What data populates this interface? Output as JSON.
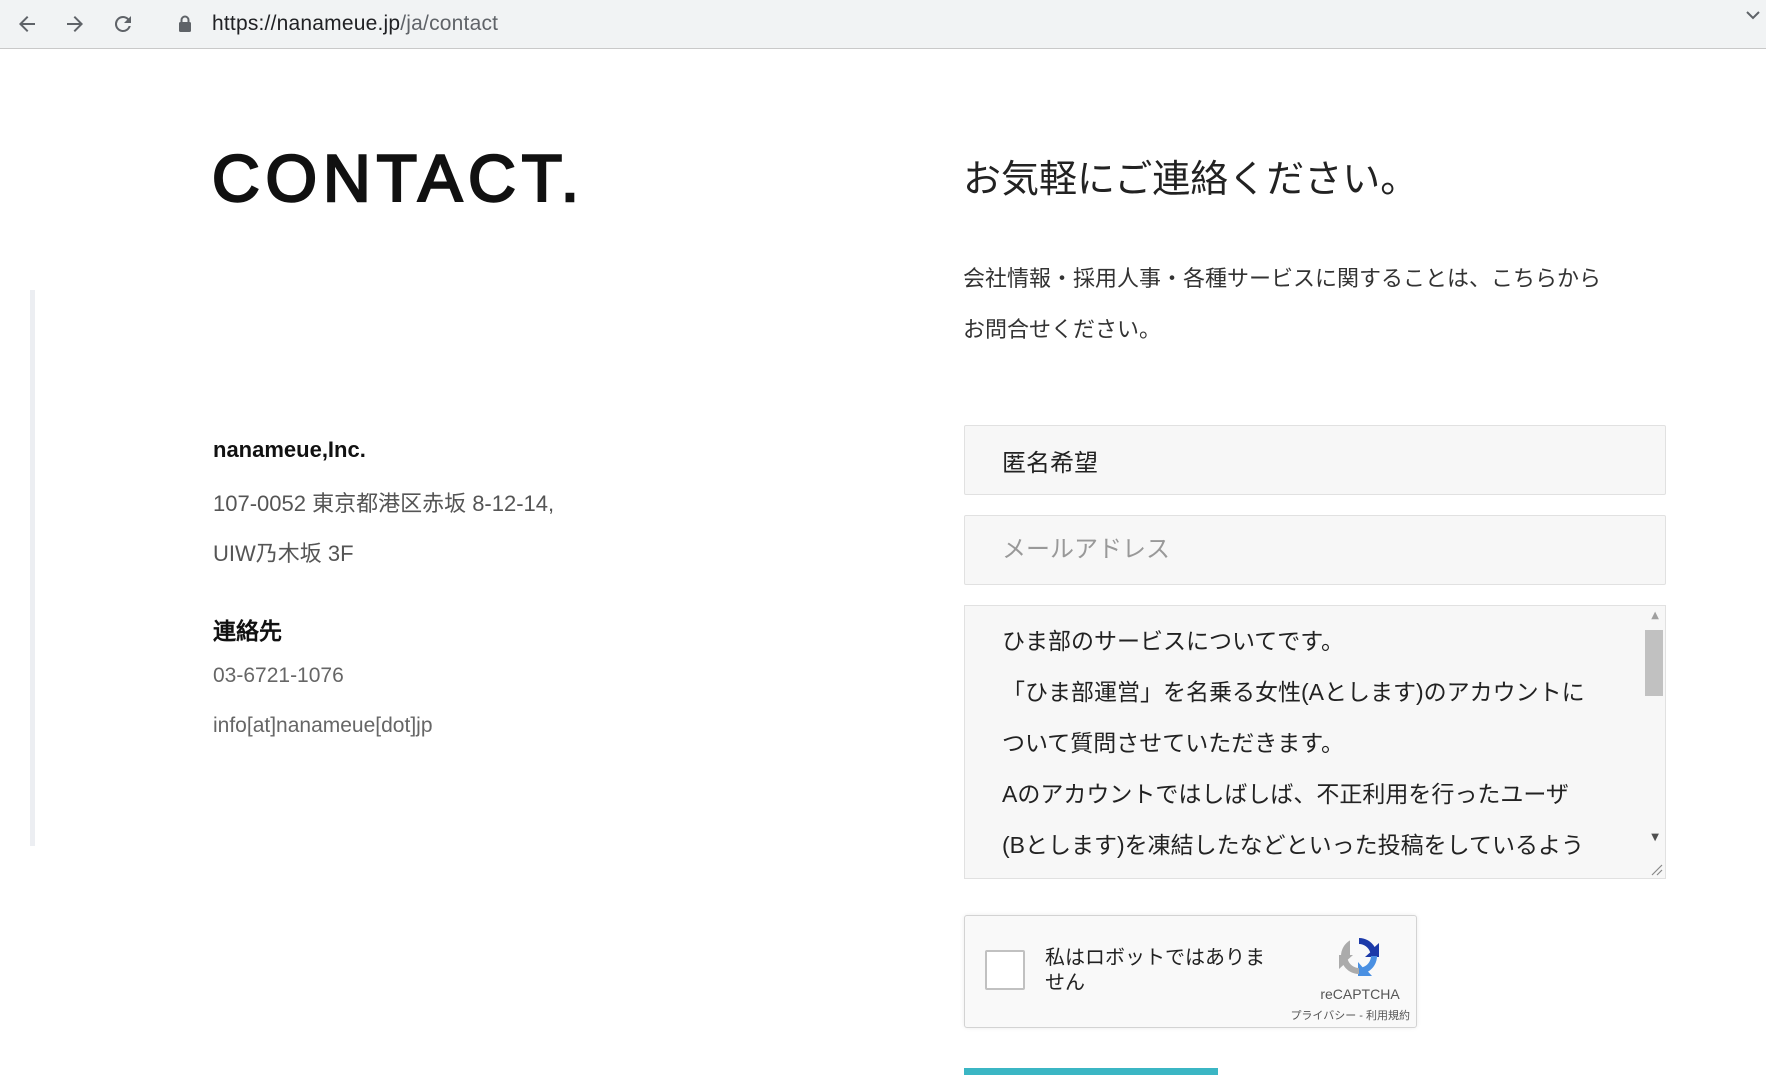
{
  "browser": {
    "url_host": "https://nanameue.jp",
    "url_path": "/ja/contact"
  },
  "left": {
    "logo": "CONTACT.",
    "company": "nanameue,Inc.",
    "address_line1": "107-0052 東京都港区赤坂 8-12-14,",
    "address_line2": "UIW乃木坂 3F",
    "contact_heading": "連絡先",
    "phone": "03-6721-1076",
    "email": "info[at]nanameue[dot]jp"
  },
  "right": {
    "heading": "お気軽にご連絡ください。",
    "description_line1": "会社情報・採用人事・各種サービスに関することは、こちらから",
    "description_line2": "お問合せください。"
  },
  "form": {
    "name_value": "匿名希望",
    "email_placeholder": "メールアドレス",
    "message_lines": [
      "ひま部のサービスについてです。",
      "「ひま部運営」を名乗る女性(Aとします)のアカウントに",
      "ついて質問させていただきます。",
      "Aのアカウントではしばしば、不正利用を行ったユーザ",
      "(Bとします)を凍結したなどといった投稿をしているよう"
    ]
  },
  "recaptcha": {
    "label": "私はロボットではありません",
    "brand": "reCAPTCHA",
    "links": "プライバシー - 利用規約"
  },
  "colors": {
    "accent": "#3bb6c4"
  }
}
